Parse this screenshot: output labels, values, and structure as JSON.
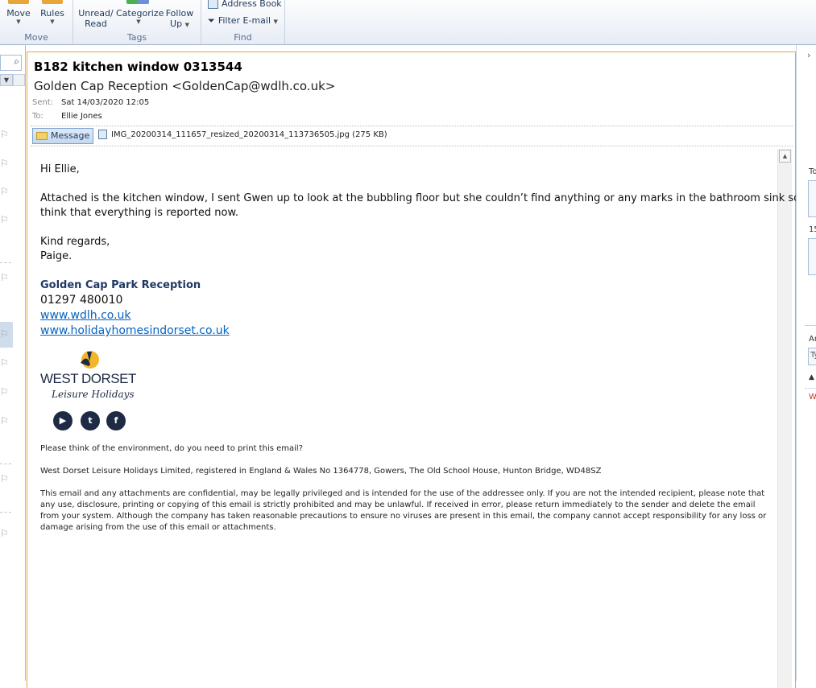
{
  "ribbon": {
    "move_group": {
      "move_label": "Move",
      "rules_label": "Rules",
      "group_label": "Move"
    },
    "tags_group": {
      "unread_label_1": "Unread/",
      "unread_label_2": "Read",
      "categorize_label": "Categorize",
      "follow_label_1": "Follow",
      "follow_label_2": "Up",
      "group_label": "Tags"
    },
    "find_group": {
      "address_book_label": "Address Book",
      "filter_label": "Filter E-mail",
      "group_label": "Find"
    }
  },
  "message": {
    "subject": "B182 kitchen window 0313544",
    "from": "Golden Cap Reception <GoldenCap@wdlh.co.uk>",
    "sent_label": "Sent:",
    "sent_value": "Sat 14/03/2020 12:05",
    "to_label": "To:",
    "to_value": "Ellie Jones",
    "message_tab_label": "Message",
    "attachment_name": "IMG_20200314_111657_resized_20200314_113736505.jpg (275 KB)"
  },
  "body": {
    "greeting": "Hi Ellie,",
    "line1": "Attached is the kitchen window, I sent Gwen up to look at the bubbling floor but she couldn’t find anything or any marks in the bathroom sink so I",
    "line2": "think that everything is reported now.",
    "closing1": "Kind regards,",
    "closing2": "Paige.",
    "sig_name": "Golden Cap Park Reception",
    "sig_phone": "01297 480010",
    "sig_link1": "www.wdlh.co.uk",
    "sig_link2": "www.holidayhomesindorset.co.uk",
    "logo_line1": "WEST DORSET",
    "logo_line2": "Leisure Holidays",
    "env_note": "Please think of the environment, do you need to print this email?",
    "company_note": "West Dorset Leisure Holidays Limited, registered in England & Wales No 1364778, Gowers, The Old School House, Hunton Bridge, WD48SZ",
    "disclaimer": "This email and any attachments are confidential, may be legally privileged and is intended for the use of the addressee only. If you are not the intended recipient, please note that any use, disclosure, printing or copying of this email is strictly prohibited and may be unlawful. If received in error, please return immediately to the sender and delete the email from your system. Although the company has taken reasonable precautions to ensure no viruses are present in this email, the company cannot accept responsibility for any loss or damage arising from the use of this email or attachments."
  },
  "right_pane": {
    "label1": "To",
    "label2": "15",
    "label3": "Ar",
    "label4": "Ty",
    "label5": "W"
  },
  "colors": {
    "accent_border": "#e6a64a",
    "signature_name": "#1f3864",
    "link": "#0563c1"
  }
}
